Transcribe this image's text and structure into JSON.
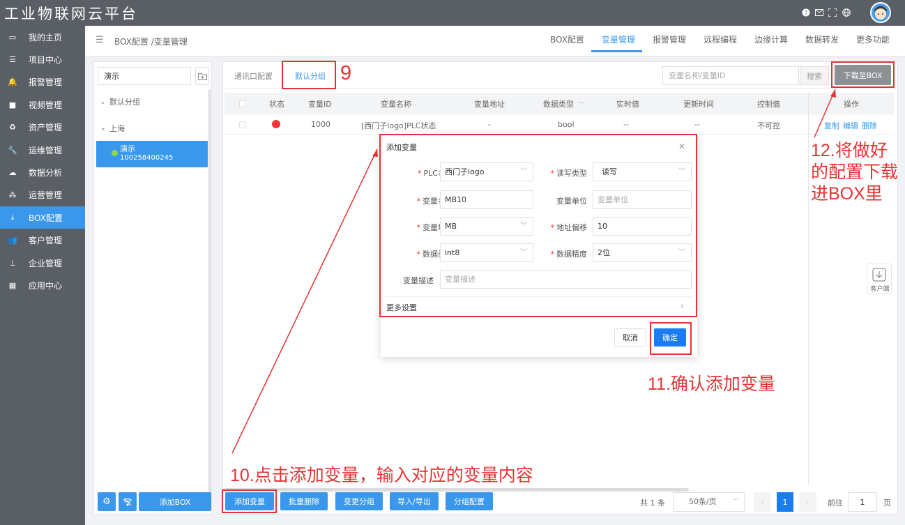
{
  "app": {
    "title": "工业物联网云平台"
  },
  "topbar_icons": [
    "help-icon",
    "mail-icon",
    "fullscreen-icon",
    "globe-icon"
  ],
  "sidebar": {
    "items": [
      {
        "label": "我的主页",
        "icon": "laptop-icon",
        "active": false
      },
      {
        "label": "项目中心",
        "icon": "list-icon",
        "active": false
      },
      {
        "label": "报警管理",
        "icon": "bell-icon",
        "active": false
      },
      {
        "label": "视频管理",
        "icon": "video-icon",
        "active": false
      },
      {
        "label": "资产管理",
        "icon": "recycle-icon",
        "active": false
      },
      {
        "label": "运维管理",
        "icon": "wrench-icon",
        "active": false
      },
      {
        "label": "数据分析",
        "icon": "chart-icon",
        "active": false
      },
      {
        "label": "运营管理",
        "icon": "cubes-icon",
        "active": false
      },
      {
        "label": "BOX配置",
        "icon": "download-icon",
        "active": true
      },
      {
        "label": "客户管理",
        "icon": "users-icon",
        "active": false
      },
      {
        "label": "企业管理",
        "icon": "sitemap-icon",
        "active": false
      },
      {
        "label": "应用中心",
        "icon": "grid-icon",
        "active": false
      }
    ]
  },
  "breadcrumb": "BOX配置 /变量管理",
  "tabs": [
    {
      "label": "BOX配置"
    },
    {
      "label": "变量管理",
      "active": true
    },
    {
      "label": "报警管理"
    },
    {
      "label": "远程编程"
    },
    {
      "label": "边缘计算"
    },
    {
      "label": "数据转发"
    },
    {
      "label": "更多功能"
    }
  ],
  "tree": {
    "search_value": "演示",
    "nodes": {
      "default_group": "默认分组",
      "shanghai": "上海",
      "demo_name": "演示",
      "demo_id": "100258400245"
    }
  },
  "left_bottom": {
    "add_box": "添加BOX"
  },
  "subtabs": [
    {
      "label": "通讯口配置"
    },
    {
      "label": "默认分组",
      "active": true
    }
  ],
  "search": {
    "placeholder": "变量名称/变量ID",
    "button": "搜索"
  },
  "download_button": "下载至BOX",
  "table": {
    "headers": [
      "状态",
      "变量ID",
      "变量名称",
      "变量地址",
      "数据类型",
      "实时值",
      "更新时间",
      "控制值",
      "操作"
    ],
    "rows": [
      {
        "status_color": "#f23535",
        "id": "1000",
        "name": "[西门子logo]PLC状态",
        "address": "-",
        "type": "bool",
        "realtime": "--",
        "updated": "--",
        "control": "不可控",
        "actions": [
          "复制",
          "编辑",
          "删除"
        ]
      }
    ]
  },
  "bottom_buttons": [
    "添加变量",
    "批量删除",
    "变更分组",
    "导入/导出",
    "分组配置"
  ],
  "pagination": {
    "total": "共 1 条",
    "page_size": "50条/页",
    "current": "1",
    "goto_label": "前往",
    "goto_value": "1",
    "page_unit": "页"
  },
  "client_widget": {
    "label": "客户端"
  },
  "dialog": {
    "title": "添加变量",
    "fields": {
      "plc": {
        "label": "PLC名称",
        "value": "西门子logo"
      },
      "rw": {
        "label": "读写类型",
        "value": "读写"
      },
      "name": {
        "label": "变量名称",
        "value": "MB10"
      },
      "unit": {
        "label": "变量单位",
        "placeholder": "变量单位"
      },
      "addr": {
        "label": "变量地址",
        "value": "MB"
      },
      "offset": {
        "label": "地址偏移",
        "value": "10"
      },
      "dtype": {
        "label": "数据类型",
        "value": "int8"
      },
      "precision": {
        "label": "数据精度",
        "value": "2位"
      },
      "desc": {
        "label": "变量描述",
        "placeholder": "变量描述"
      }
    },
    "more": "更多设置",
    "cancel": "取消",
    "confirm": "确定"
  },
  "annotations": {
    "a9": "9",
    "a10": "10.点击添加变量，输入对应的变量内容",
    "a11": "11.确认添加变量",
    "a12_lines": [
      "12.将做好",
      "的配置下载",
      "进BOX里"
    ]
  },
  "colors": {
    "accent": "#3a98ec",
    "sidebar": "#5a5f66",
    "annotation": "#e53333",
    "status_dot": "#f23535"
  }
}
